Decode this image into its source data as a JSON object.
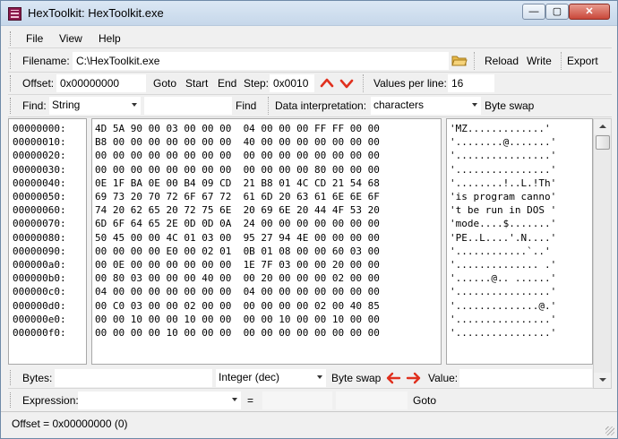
{
  "window": {
    "title": "HexToolkit: HexToolkit.exe"
  },
  "menu": [
    "File",
    "View",
    "Help"
  ],
  "file_row": {
    "filename_label": "Filename:",
    "filename_value": "C:\\HexToolkit.exe",
    "reload": "Reload",
    "write": "Write",
    "export": "Export"
  },
  "offset_row": {
    "offset_label": "Offset:",
    "offset_value": "0x00000000",
    "goto": "Goto",
    "start": "Start",
    "end": "End",
    "step_label": "Step:",
    "step_value": "0x0010",
    "values_per_line_label": "Values per line:",
    "values_per_line_value": "16"
  },
  "find_row": {
    "find_label": "Find:",
    "find_type": "String",
    "find_value": "",
    "find_button": "Find",
    "interp_label": "Data interpretation:",
    "interp_value": "characters",
    "byte_swap": "Byte swap"
  },
  "offsets": "00000000:\n00000010:\n00000020:\n00000030:\n00000040:\n00000050:\n00000060:\n00000070:\n00000080:\n00000090:\n000000a0:\n000000b0:\n000000c0:\n000000d0:\n000000e0:\n000000f0:",
  "hex": "4D 5A 90 00 03 00 00 00  04 00 00 00 FF FF 00 00\nB8 00 00 00 00 00 00 00  40 00 00 00 00 00 00 00\n00 00 00 00 00 00 00 00  00 00 00 00 00 00 00 00\n00 00 00 00 00 00 00 00  00 00 00 00 80 00 00 00\n0E 1F BA 0E 00 B4 09 CD  21 B8 01 4C CD 21 54 68\n69 73 20 70 72 6F 67 72  61 6D 20 63 61 6E 6E 6F\n74 20 62 65 20 72 75 6E  20 69 6E 20 44 4F 53 20\n6D 6F 64 65 2E 0D 0D 0A  24 00 00 00 00 00 00 00\n50 45 00 00 4C 01 03 00  95 27 94 4E 00 00 00 00\n00 00 00 00 E0 00 02 01  0B 01 08 00 00 60 03 00\n00 0E 00 00 00 00 00 00  1E 7F 03 00 00 20 00 00\n00 80 03 00 00 00 40 00  00 20 00 00 00 02 00 00\n04 00 00 00 00 00 00 00  04 00 00 00 00 00 00 00\n00 C0 03 00 00 02 00 00  00 00 00 00 02 00 40 85\n00 00 10 00 00 10 00 00  00 00 10 00 00 10 00 00\n00 00 00 00 10 00 00 00  00 00 00 00 00 00 00 00",
  "text": "'MZ.............'\n'........@.......'\n'................'\n'................'\n'........!..L.!Th'\n'is program canno'\n't be run in DOS '\n'mode....$.......'\n'PE..L....'.N....'\n'............`..'\n'.............. .'\n'......@.. ......'\n'................'\n'..............@.'\n'................'\n'................'",
  "bytes_row": {
    "bytes_label": "Bytes:",
    "int_type": "Integer (dec)",
    "byte_swap": "Byte swap",
    "value_label": "Value:"
  },
  "expr_row": {
    "expression_label": "Expression:",
    "equals": "=",
    "goto": "Goto"
  },
  "status": {
    "text": "Offset = 0x00000000 (0)"
  },
  "colors": {
    "arrow_red": "#e0301e",
    "title_bg": "#c6d7ea",
    "app_icon": "#8b1a4c"
  }
}
